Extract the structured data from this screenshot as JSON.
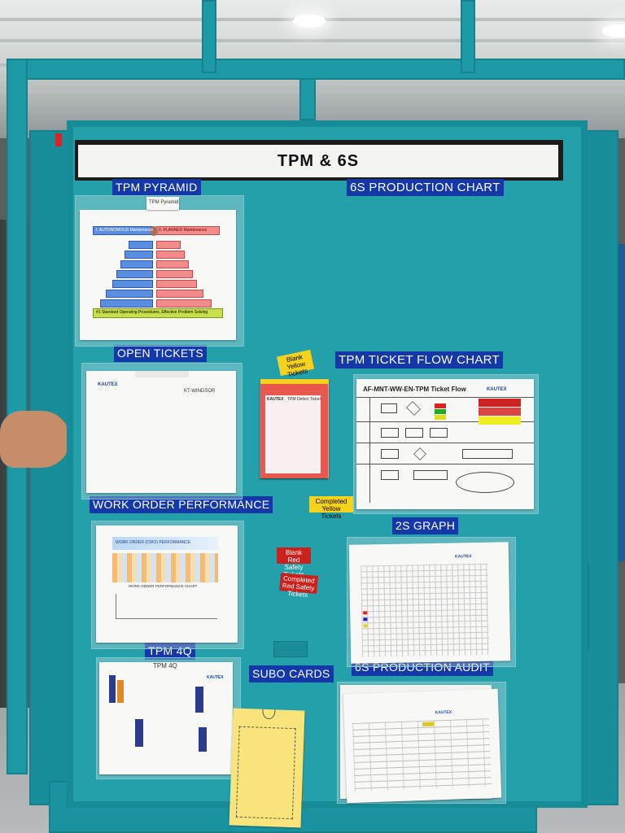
{
  "board": {
    "title": "TPM & 6S",
    "labels": {
      "tpm_pyramid": "TPM PYRAMID",
      "production_chart": "6S PRODUCTION CHART",
      "open_tickets": "OPEN TICKETS",
      "ticket_flow": "TPM TICKET FLOW CHART",
      "work_order": "WORK ORDER PERFORMANCE",
      "graph_2s": "2S GRAPH",
      "tpm_4q": "TPM 4Q",
      "subo_cards": "SUBO CARDS",
      "production_audit": "6S PRODUCTION AUDIT"
    }
  },
  "pyramid_sheet": {
    "header": "TPM Pyramid",
    "left_top": "I. AUTONOMOUS Maintenance",
    "right_top": "II. PLANNED Maintenance",
    "base": "#1 Standard Operating Procedures, Effective Problem Solving"
  },
  "open_tickets_sheet": {
    "logo": "KAUTEX",
    "site": "KT-WINDSOR"
  },
  "tags": {
    "blank_yellow": "Blank Yellow Tickets",
    "completed_yellow": "Completed Yellow Tickets",
    "blank_red": "Blank Red Safety Tickets",
    "completed_red": "Completed Red Safety Tickets"
  },
  "red_ticket": {
    "brand": "KAUTEX",
    "title": "TPM Defect Ticket"
  },
  "flow_sheet": {
    "title": "AF-MNT-WW-EN-TPM Ticket Flow",
    "logo": "KAUTEX"
  },
  "work_order_sheet": {
    "title": "WORK ORDER (CWO) PERFORMANCE",
    "chart_title": "WORK ORDER PERFORMANCE CHART"
  },
  "graph_sheet": {
    "logo": "KAUTEX"
  },
  "tpm4q_sheet": {
    "header": "TPM 4Q",
    "logo": "KAUTEX"
  },
  "audit_sheet": {
    "logo": "KAUTEX"
  },
  "colors": {
    "cart": "#1f97a3",
    "label_blue": "#1538a8",
    "yellow_tag": "#f6d21c",
    "red_tag": "#c8211e"
  }
}
